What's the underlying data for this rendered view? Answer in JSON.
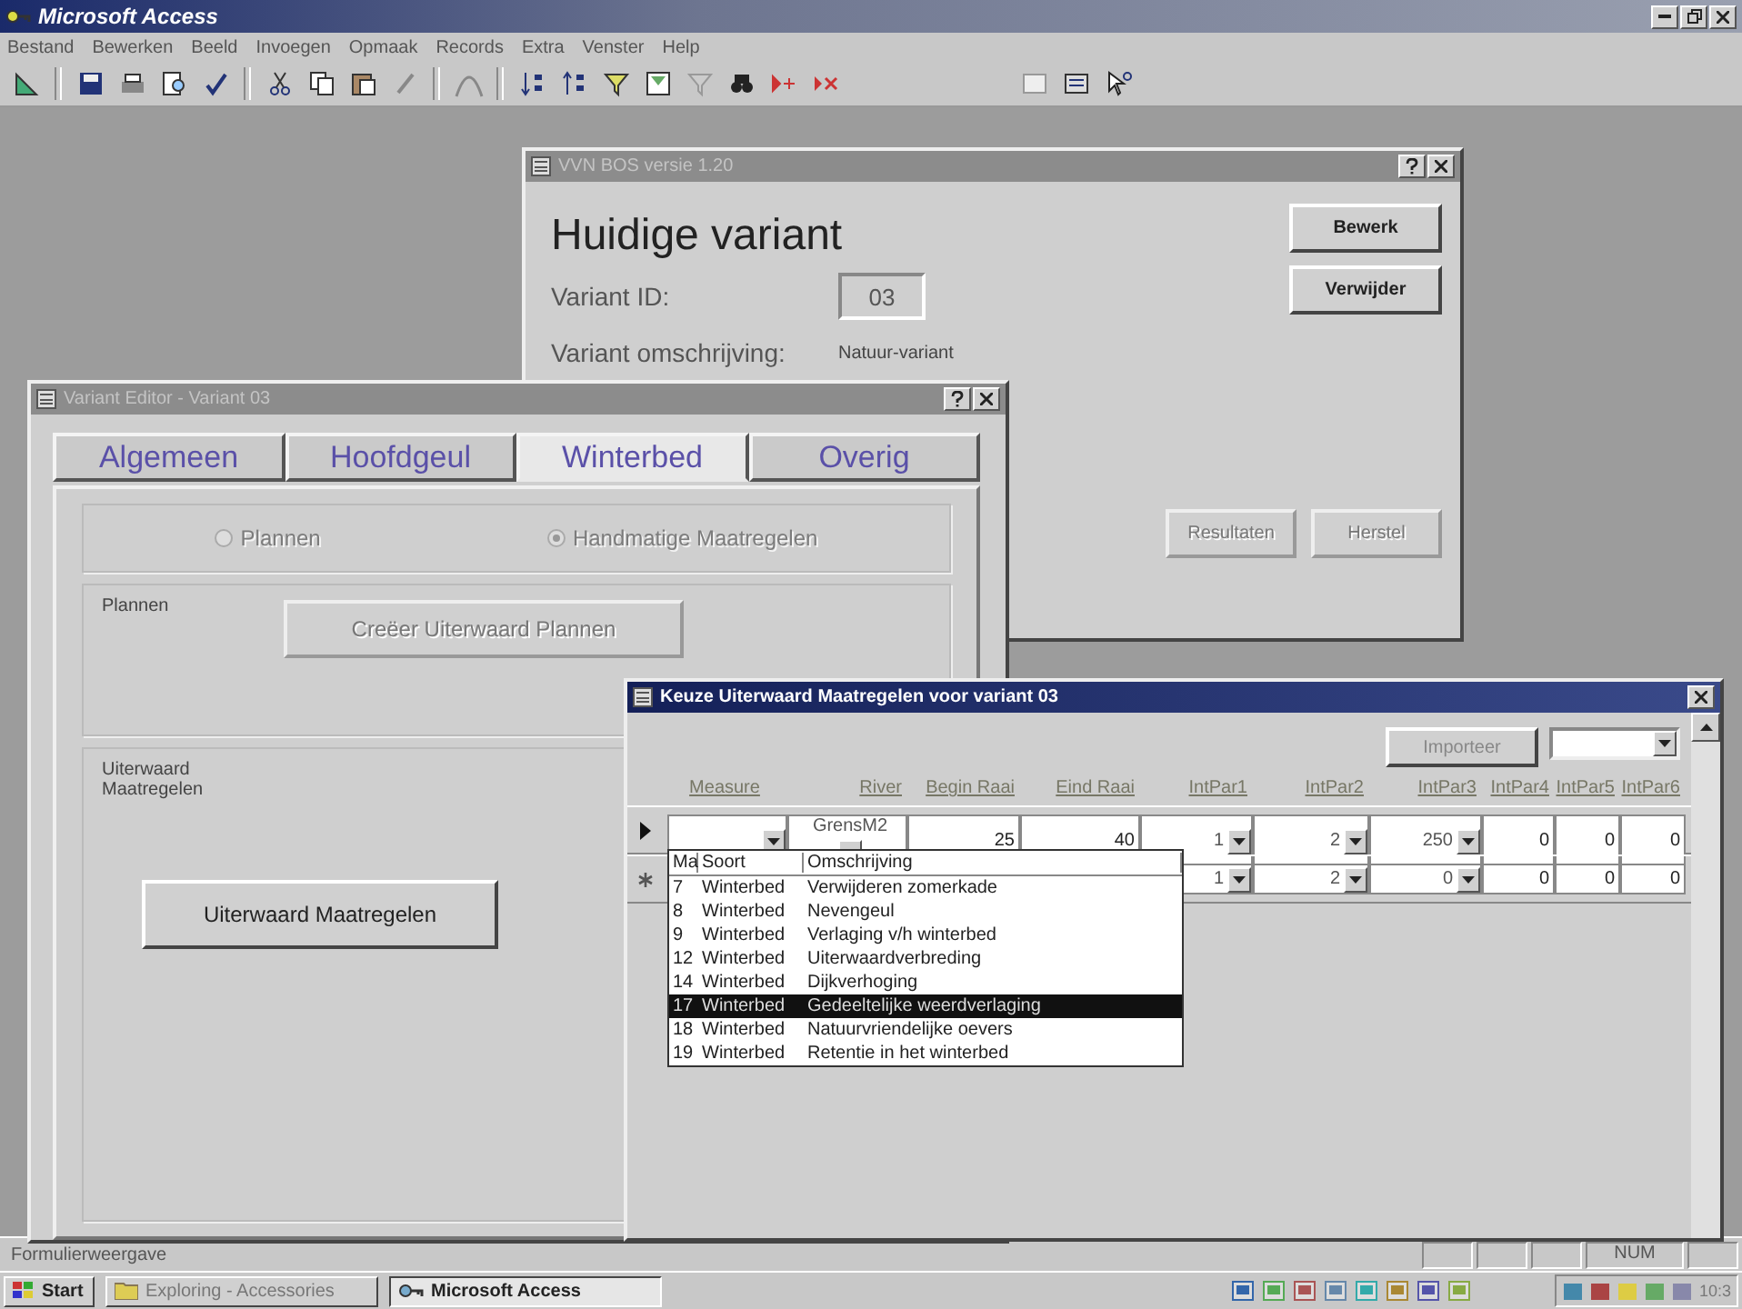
{
  "app": {
    "title": "Microsoft Access"
  },
  "menu": [
    {
      "label": "Bestand"
    },
    {
      "label": "Bewerken"
    },
    {
      "label": "Beeld"
    },
    {
      "label": "Invoegen"
    },
    {
      "label": "Opmaak"
    },
    {
      "label": "Records"
    },
    {
      "label": "Extra"
    },
    {
      "label": "Venster"
    },
    {
      "label": "Help"
    }
  ],
  "variant_window": {
    "title": "VVN BOS versie 1.20",
    "heading": "Huidige variant",
    "id_label": "Variant ID:",
    "id_value": "03",
    "description_label": "Variant omschrijving:",
    "description_value": "Natuur-variant",
    "side_buttons": [
      {
        "label": "Bewerk",
        "disabled": false
      },
      {
        "label": "Verwijder",
        "disabled": false
      }
    ],
    "bottom_buttons": [
      {
        "label": "Resultaten",
        "disabled": true
      },
      {
        "label": "Herstel",
        "disabled": true
      }
    ]
  },
  "editor_window": {
    "title": "Variant Editor - Variant 03",
    "tabs": [
      {
        "label": "Algemeen",
        "selected": false
      },
      {
        "label": "Hoofdgeul",
        "selected": false
      },
      {
        "label": "Winterbed",
        "selected": true
      },
      {
        "label": "Overig",
        "selected": false
      }
    ],
    "radios": [
      {
        "label": "Plannen",
        "checked": false,
        "disabled": true
      },
      {
        "label": "Handmatige Maatregelen",
        "checked": true,
        "disabled": true
      }
    ],
    "plans_group": {
      "label": "Plannen",
      "button": {
        "label": "Creëer Uiterwaard Plannen",
        "disabled": true
      }
    },
    "measures_group": {
      "label": "Uiterwaard Maatregelen",
      "button": {
        "label": "Uiterwaard Maatregelen",
        "disabled": false
      }
    }
  },
  "keuze_window": {
    "title": "Keuze Uiterwaard Maatregelen voor variant 03",
    "import_button": "Importeer",
    "columns": [
      "Measure",
      "River",
      "Begin Raai",
      "Eind Raai",
      "IntPar1",
      "IntPar2",
      "IntPar3",
      "IntPar4",
      "IntPar5",
      "IntPar6"
    ],
    "rows": [
      {
        "kind": "current",
        "cells": [
          {
            "kind": "combo"
          },
          {
            "kind": "combo",
            "value": "GrensM2"
          },
          {
            "kind": "text",
            "value": "25"
          },
          {
            "kind": "text",
            "value": "40"
          },
          {
            "kind": "combo",
            "value": "1"
          },
          {
            "kind": "combo",
            "value": "2"
          },
          {
            "kind": "combo",
            "value": "250"
          },
          {
            "kind": "text",
            "value": "0"
          },
          {
            "kind": "text",
            "value": "0"
          },
          {
            "kind": "text",
            "value": "0"
          }
        ]
      },
      {
        "kind": "new",
        "cells": [
          "",
          "",
          "",
          "",
          {
            "kind": "combo",
            "value": "1"
          },
          {
            "kind": "combo",
            "value": "2"
          },
          {
            "kind": "combo",
            "value": "0"
          },
          {
            "kind": "text",
            "value": "0"
          },
          {
            "kind": "text",
            "value": "0"
          },
          {
            "kind": "text",
            "value": "0"
          }
        ]
      }
    ],
    "dropdown": {
      "columns": [
        "Ma",
        "Soort",
        "Omschrijving"
      ],
      "rows": [
        {
          "cells": [
            "7",
            "Winterbed",
            "Verwijderen zomerkade"
          ],
          "selected": false
        },
        {
          "cells": [
            "8",
            "Winterbed",
            "Nevengeul"
          ],
          "selected": false
        },
        {
          "cells": [
            "9",
            "Winterbed",
            "Verlaging v/h winterbed"
          ],
          "selected": false
        },
        {
          "cells": [
            "12",
            "Winterbed",
            "Uiterwaardverbreding"
          ],
          "selected": false
        },
        {
          "cells": [
            "14",
            "Winterbed",
            "Dijkverhoging"
          ],
          "selected": false
        },
        {
          "cells": [
            "17",
            "Winterbed",
            "Gedeeltelijke weerdverlaging"
          ],
          "selected": true
        },
        {
          "cells": [
            "18",
            "Winterbed",
            "Natuurvriendelijke oevers"
          ],
          "selected": false
        },
        {
          "cells": [
            "19",
            "Winterbed",
            "Retentie in het winterbed"
          ],
          "selected": false
        }
      ]
    }
  },
  "status_bar": {
    "text": "Formulierweergave",
    "indicator": "NUM"
  },
  "taskbar": {
    "start": "Start",
    "items": [
      {
        "label": "Exploring - Accessories",
        "selected": false
      },
      {
        "label": "Microsoft Access",
        "selected": true
      }
    ],
    "clock": "10:3"
  }
}
